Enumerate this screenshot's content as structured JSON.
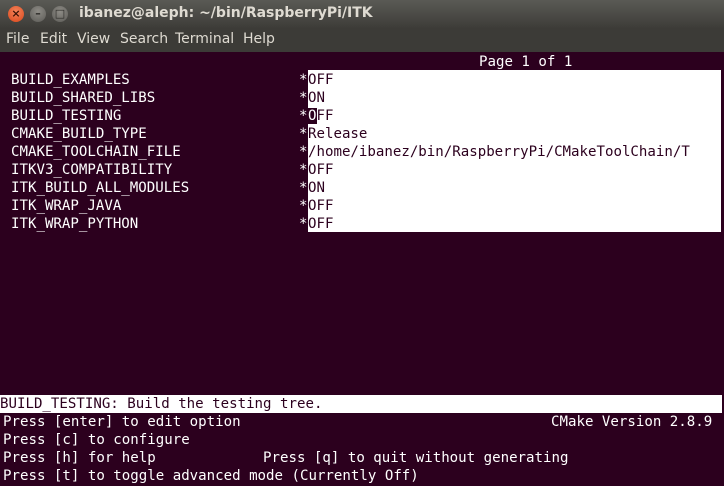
{
  "window": {
    "title": "ibanez@aleph: ~/bin/RaspberryPi/ITK",
    "close_glyph": "×",
    "min_glyph": "–",
    "max_glyph": "□"
  },
  "menu": [
    "File",
    "Edit",
    "View",
    "Search",
    "Terminal",
    "Help"
  ],
  "terminal": {
    "page_indicator": "Page 1 of 1",
    "options": [
      {
        "name": "BUILD_EXAMPLES",
        "value": "OFF"
      },
      {
        "name": "BUILD_SHARED_LIBS",
        "value": "ON"
      },
      {
        "name": "BUILD_TESTING",
        "value": "OFF"
      },
      {
        "name": "CMAKE_BUILD_TYPE",
        "value": "Release"
      },
      {
        "name": "CMAKE_TOOLCHAIN_FILE",
        "value": "/home/ibanez/bin/RaspberryPi/CMakeToolChain/T"
      },
      {
        "name": "ITKV3_COMPATIBILITY",
        "value": "OFF"
      },
      {
        "name": "ITK_BUILD_ALL_MODULES",
        "value": "ON"
      },
      {
        "name": "ITK_WRAP_JAVA",
        "value": "OFF"
      },
      {
        "name": "ITK_WRAP_PYTHON",
        "value": "OFF"
      }
    ],
    "marker": "*",
    "status_line": "BUILD_TESTING: Build the testing tree.",
    "help_lines": [
      "Press [enter] to edit option",
      "Press [c] to configure",
      "Press [h] for help",
      "Press [t] to toggle advanced mode (Currently Off)"
    ],
    "version": "CMake Version 2.8.9",
    "quit_help": "Press [q] to quit without generating"
  }
}
